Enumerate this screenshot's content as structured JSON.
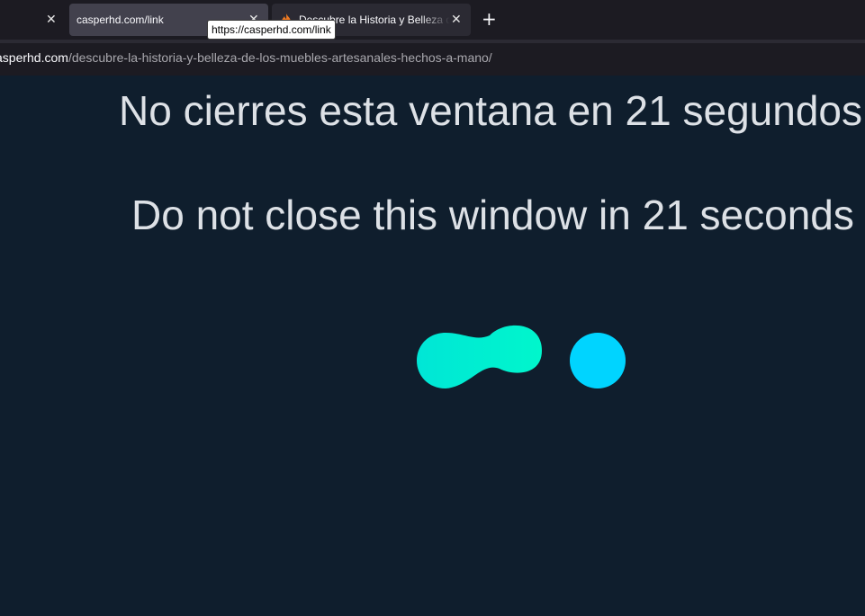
{
  "browser": {
    "tabs": [
      {
        "label": "casperhd.com/link",
        "active": true
      },
      {
        "label": "Descubre la Historia y Belleza de",
        "active": false,
        "favicon": "flame-icon"
      }
    ],
    "tooltip": "https://casperhd.com/link",
    "new_tab_icon": "plus-icon",
    "close_icon": "close-icon",
    "address": {
      "domain": "casperhd.com",
      "path": "/descubre-la-historia-y-belleza-de-los-muebles-artesanales-hechos-a-mano/"
    }
  },
  "page": {
    "message_es": "No cierres esta ventana en 21 segundos",
    "message_en": "Do not close this window in 21 seconds",
    "loader_icon": "loading-animation-icon",
    "colors": {
      "background": "#0f1e2d",
      "text": "#dde1e6",
      "loader_teal": "#00f0d8",
      "loader_blue": "#00d4ff"
    }
  }
}
